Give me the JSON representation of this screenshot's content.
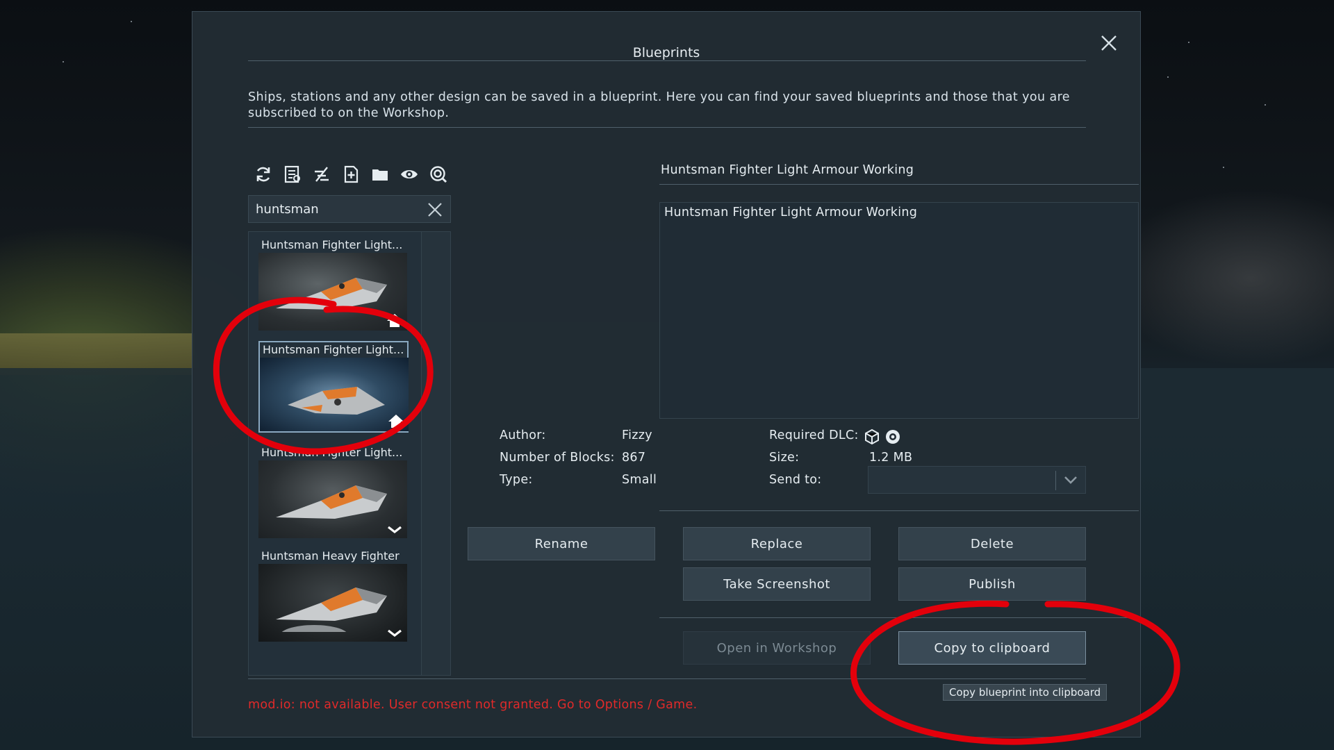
{
  "dialog": {
    "title": "Blueprints",
    "description": "Ships, stations and any other design can be saved in a blueprint. Here you can find your saved blueprints and those that you are subscribed to on the Workshop."
  },
  "toolbar": {
    "icons": [
      "refresh-icon",
      "filter-blueprint-icon",
      "sort-icon",
      "new-blueprint-icon",
      "folder-icon",
      "eye-icon",
      "search-workshop-icon"
    ]
  },
  "search": {
    "value": "huntsman"
  },
  "list": {
    "items": [
      {
        "label": "Huntsman Fighter Light...",
        "badge": "home-icon",
        "selected": false
      },
      {
        "label": "Huntsman Fighter Light...",
        "badge": "home-icon",
        "selected": true
      },
      {
        "label": "Huntsman Fighter Light...",
        "badge": "workshop-icon",
        "selected": false
      },
      {
        "label": "Huntsman Heavy Fighter",
        "badge": "workshop-icon",
        "selected": false
      }
    ]
  },
  "detail": {
    "name": "Huntsman Fighter Light Armour Working",
    "description": "Huntsman Fighter Light Armour Working",
    "author_label": "Author:",
    "author": "Fizzy",
    "blocks_label": "Number of Blocks:",
    "blocks": "867",
    "type_label": "Type:",
    "type": "Small",
    "dlc_label": "Required DLC:",
    "size_label": "Size:",
    "size": "1.2 MB",
    "sendto_label": "Send to:",
    "sendto_value": ""
  },
  "buttons": {
    "rename": "Rename",
    "replace": "Replace",
    "delete": "Delete",
    "screenshot": "Take Screenshot",
    "publish": "Publish",
    "open_workshop": "Open in Workshop",
    "copy_clipboard": "Copy to clipboard"
  },
  "tooltip": "Copy blueprint into clipboard",
  "warning": "mod.io: not available. User consent not granted. Go to Options / Game.",
  "colors": {
    "warning": "#e02a2a",
    "annotation": "#e3000b"
  }
}
